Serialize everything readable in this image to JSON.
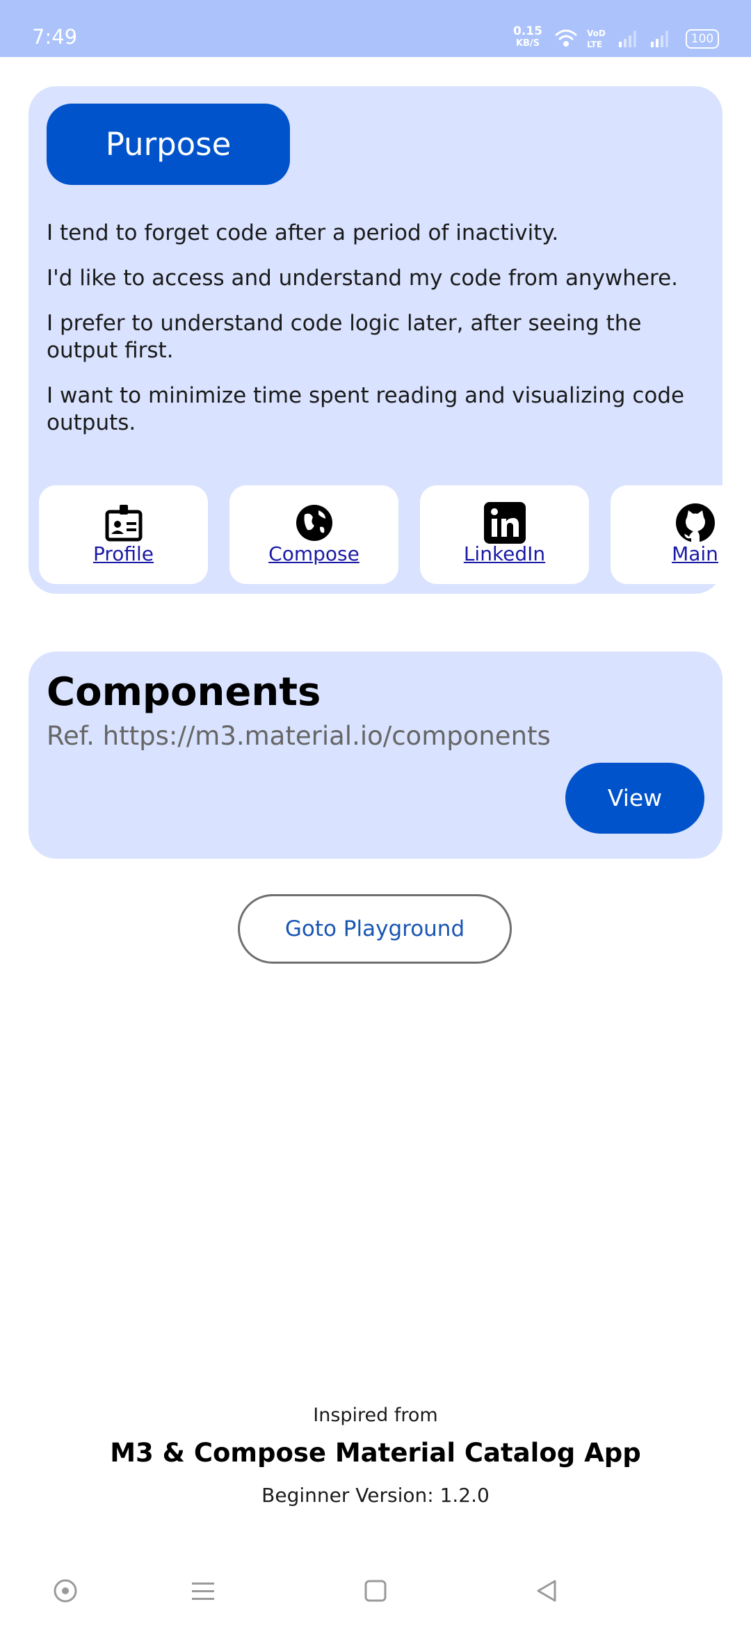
{
  "status_bar": {
    "time": "7:49",
    "net_speed": "0.15",
    "net_speed_unit": "KB/S",
    "battery": "100",
    "icons": [
      "wifi-icon",
      "volte-icon",
      "signal-icon",
      "signal-icon",
      "battery-icon"
    ]
  },
  "purpose": {
    "title": "Purpose",
    "lines": [
      "I tend to forget code after a period of inactivity.",
      "I'd like to access and understand my code from anywhere.",
      "I prefer to understand code logic later, after seeing the output first.",
      "I want to minimize time spent reading and visualizing code outputs."
    ],
    "links": [
      {
        "label": "Profile",
        "icon": "badge-icon"
      },
      {
        "label": "Compose",
        "icon": "globe-icon"
      },
      {
        "label": "LinkedIn",
        "icon": "linkedin-icon"
      },
      {
        "label": "Main",
        "icon": "github-icon"
      }
    ]
  },
  "components": {
    "title": "Components",
    "ref": "Ref. https://m3.material.io/components",
    "view_label": "View"
  },
  "goto_label": "Goto Playground",
  "footer": {
    "inspired": "Inspired from",
    "app": "M3 & Compose Material Catalog App",
    "version": "Beginner Version: 1.2.0"
  },
  "nav_bar": {
    "icons": [
      "assistant-icon",
      "menu-icon",
      "home-icon",
      "back-icon"
    ]
  },
  "colors": {
    "status_bar": "#abc2fb",
    "card": "#d9e2fe",
    "primary": "#0053cb",
    "link": "#1a1aa6",
    "outline": "#6f6f6f"
  }
}
